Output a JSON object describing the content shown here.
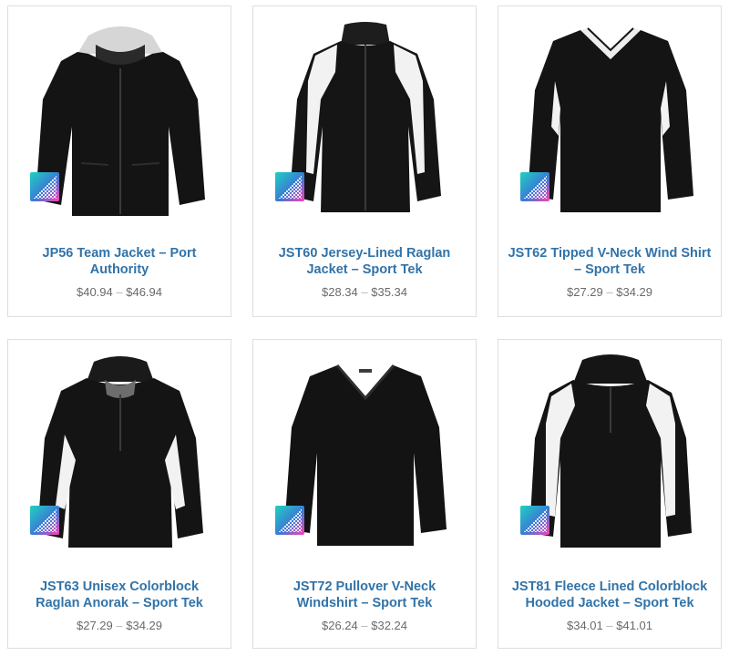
{
  "products": [
    {
      "title": "JP56 Team Jacket – Port Authority",
      "price_low": "$40.94",
      "price_high": "$46.94",
      "icon": "hooded-jacket-image"
    },
    {
      "title": "JST60 Jersey-Lined Raglan Jacket – Sport Tek",
      "price_low": "$28.34",
      "price_high": "$35.34",
      "icon": "raglan-jacket-image"
    },
    {
      "title": "JST62 Tipped V-Neck Wind Shirt – Sport Tek",
      "price_low": "$27.29",
      "price_high": "$34.29",
      "icon": "wind-shirt-image"
    },
    {
      "title": "JST63 Unisex Colorblock Raglan Anorak – Sport Tek",
      "price_low": "$27.29",
      "price_high": "$34.29",
      "icon": "anorak-image"
    },
    {
      "title": "JST72 Pullover V-Neck Windshirt – Sport Tek",
      "price_low": "$26.24",
      "price_high": "$32.24",
      "icon": "pullover-windshirt-image"
    },
    {
      "title": "JST81 Fleece Lined Colorblock Hooded Jacket – Sport Tek",
      "price_low": "$34.01",
      "price_high": "$41.01",
      "icon": "fleece-hooded-jacket-image"
    }
  ],
  "price_separator": "–",
  "colors": {
    "title": "#3173a8",
    "price": "#6a6a6a",
    "border": "#dedede",
    "garment": "#141414",
    "accent": "#f2f2f2"
  }
}
